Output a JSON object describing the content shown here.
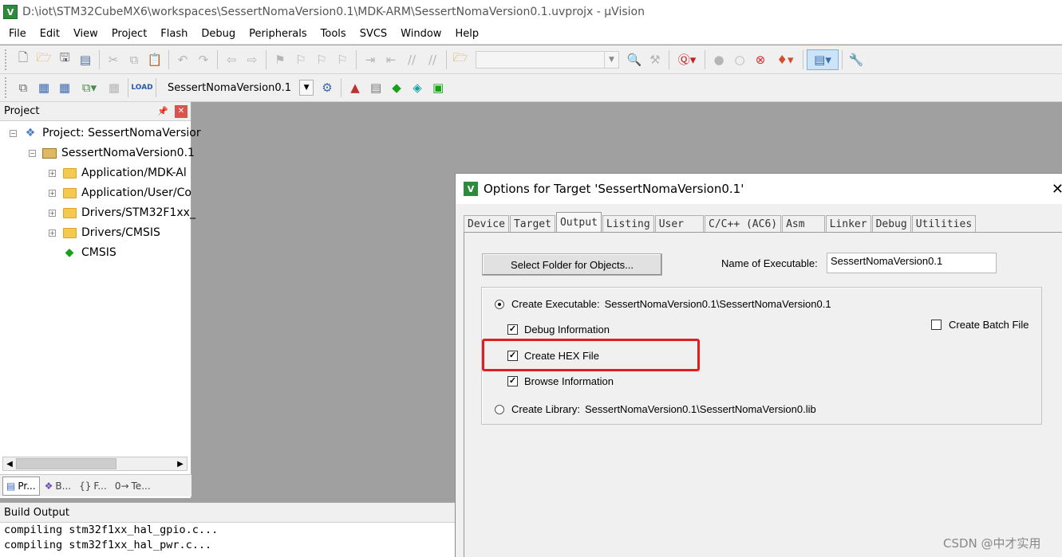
{
  "window": {
    "title": "D:\\iot\\STM32CubeMX6\\workspaces\\SessertNomaVersion0.1\\MDK-ARM\\SessertNomaVersion0.1.uvprojx - µVision",
    "logo_letter": "V"
  },
  "menu": [
    "File",
    "Edit",
    "View",
    "Project",
    "Flash",
    "Debug",
    "Peripherals",
    "Tools",
    "SVCS",
    "Window",
    "Help"
  ],
  "toolbar2": {
    "target_select": "SessertNomaVersion0.1"
  },
  "project_panel": {
    "title": "Project",
    "tree": {
      "root": "Project: SessertNomaVersior",
      "target": "SessertNomaVersion0.1",
      "groups": [
        "Application/MDK-Al",
        "Application/User/Co",
        "Drivers/STM32F1xx_",
        "Drivers/CMSIS"
      ],
      "component": "CMSIS"
    },
    "tabs": [
      "Pr...",
      "B...",
      "F...",
      "Te..."
    ]
  },
  "build_output": {
    "title": "Build Output",
    "lines": [
      "compiling stm32f1xx_hal_gpio.c...",
      "compiling stm32f1xx_hal_pwr.c..."
    ]
  },
  "dialog": {
    "title": "Options for Target 'SessertNomaVersion0.1'",
    "tabs": [
      "Device",
      "Target",
      "Output",
      "Listing",
      "User",
      "C/C++ (AC6)",
      "Asm",
      "Linker",
      "Debug",
      "Utilities"
    ],
    "active_tab": "Output",
    "select_folder_button": "Select Folder for Objects...",
    "name_of_executable_label": "Name of Executable:",
    "name_of_executable_value": "SessertNomaVersion0.1",
    "create_executable_label": "Create Executable:",
    "create_executable_path": "SessertNomaVersion0.1\\SessertNomaVersion0.1",
    "debug_information": "Debug Information",
    "create_hex_file": "Create HEX File",
    "browse_information": "Browse Information",
    "create_library_label": "Create Library:",
    "create_library_path": "SessertNomaVersion0.1\\SessertNomaVersion0.lib",
    "create_batch_file": "Create Batch File",
    "checkbox_states": {
      "debug_information": true,
      "create_hex_file": true,
      "browse_information": true,
      "create_batch_file": false
    },
    "radio_selected": "create_executable"
  },
  "watermark": "CSDN @中才实用",
  "colors": {
    "highlight": "#e02020",
    "logo": "#2e8b3d"
  }
}
